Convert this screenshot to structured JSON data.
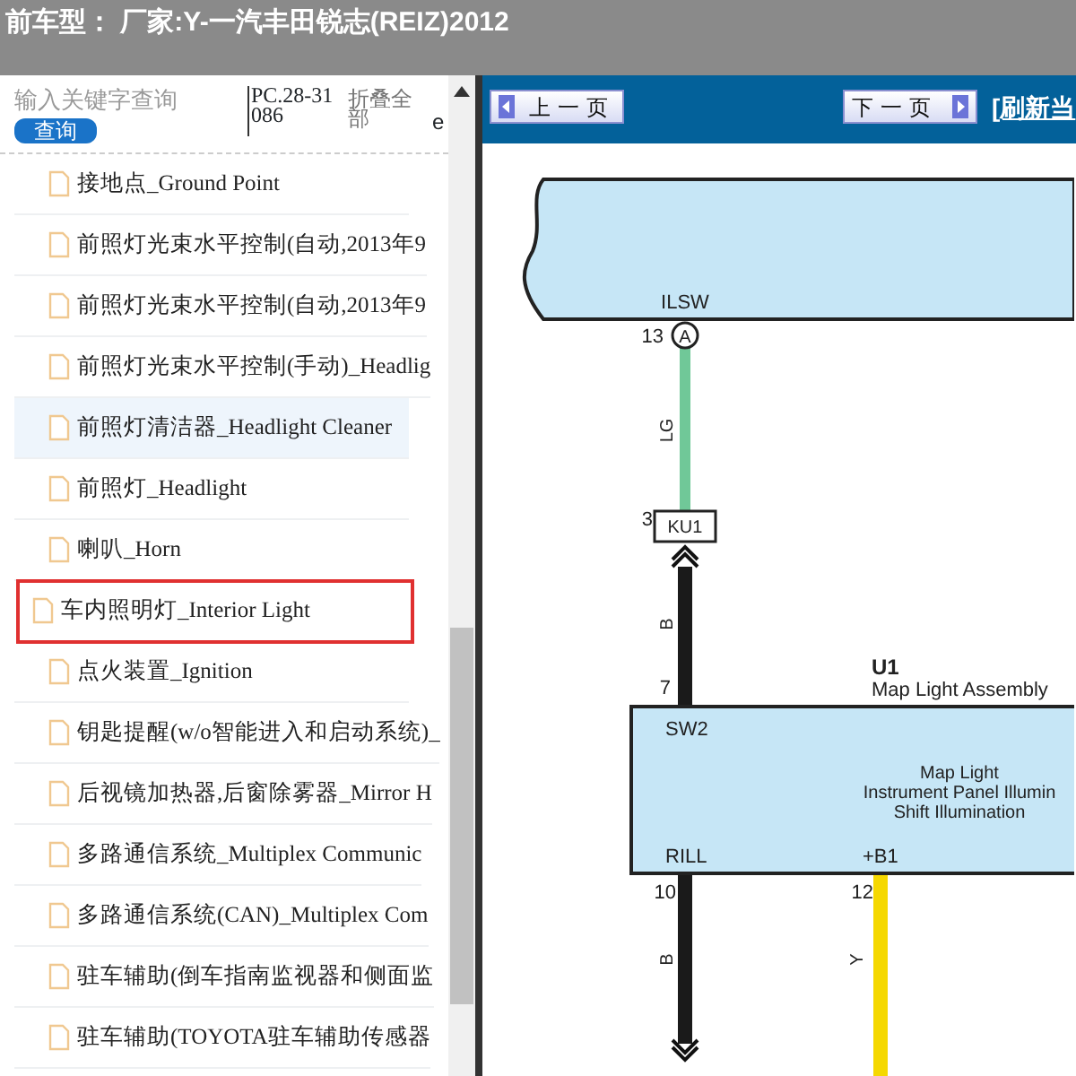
{
  "title": "前车型： 厂家:Y-一汽丰田锐志(REIZ)2012",
  "search": {
    "placeholder": "输入关键字查询",
    "button": "查询"
  },
  "code_text": "PC.28-31086",
  "collapse_all": "折叠全部",
  "cut_text": "e",
  "items": [
    {
      "label": "接地点_Ground Point",
      "selected": false,
      "outlined": false
    },
    {
      "label": "前照灯光束水平控制(自动,2013年9",
      "selected": false,
      "outlined": false
    },
    {
      "label": "前照灯光束水平控制(自动,2013年9",
      "selected": false,
      "outlined": false
    },
    {
      "label": "前照灯光束水平控制(手动)_Headlig",
      "selected": false,
      "outlined": false
    },
    {
      "label": "前照灯清洁器_Headlight Cleaner",
      "selected": true,
      "outlined": false
    },
    {
      "label": "前照灯_Headlight",
      "selected": false,
      "outlined": false
    },
    {
      "label": "喇叭_Horn",
      "selected": false,
      "outlined": false
    },
    {
      "label": "车内照明灯_Interior Light",
      "selected": false,
      "outlined": true
    },
    {
      "label": "点火装置_Ignition",
      "selected": false,
      "outlined": false
    },
    {
      "label": "钥匙提醒(w/o智能进入和启动系统)_",
      "selected": false,
      "outlined": false
    },
    {
      "label": "后视镜加热器,后窗除雾器_Mirror H",
      "selected": false,
      "outlined": false
    },
    {
      "label": "多路通信系统_Multiplex Communic",
      "selected": false,
      "outlined": false
    },
    {
      "label": "多路通信系统(CAN)_Multiplex Com",
      "selected": false,
      "outlined": false
    },
    {
      "label": "驻车辅助(倒车指南监视器和侧面监",
      "selected": false,
      "outlined": false
    },
    {
      "label": "驻车辅助(TOYOTA驻车辅助传感器",
      "selected": false,
      "outlined": false
    }
  ],
  "nav": {
    "prev": "上一页",
    "next": "下一页",
    "refresh": "[刷新当"
  },
  "diagram": {
    "top_pin_name": "ILSW",
    "top_pin_number": "13",
    "connector_a": "A",
    "wire_1_code": "LG",
    "ku1_pin": "3",
    "ku1_label": "KU1",
    "wire_2_code": "B",
    "u1_pin": "7",
    "component_id": "U1",
    "component_name": "Map Light Assembly",
    "pin_sw2": "SW2",
    "functions": [
      "Map Light",
      "Instrument Panel Illumin",
      "Shift Illumination"
    ],
    "pin_rill": "RILL",
    "pin_b1": "+B1",
    "rill_number": "10",
    "b1_number": "12",
    "wire_3_code": "B",
    "wire_4_code": "Y"
  }
}
